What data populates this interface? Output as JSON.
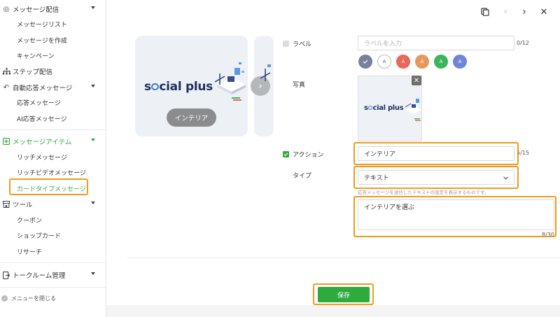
{
  "sidebar": {
    "sections": [
      {
        "label": "メッセージ配信",
        "icon": "broadcast-icon"
      },
      {
        "label": "ステップ配信",
        "icon": "step-icon"
      },
      {
        "label": "自動応答メッセージ",
        "icon": "reply-icon"
      },
      {
        "label": "メッセージアイテム",
        "icon": "message-item-icon"
      },
      {
        "label": "ツール",
        "icon": "shop-icon"
      },
      {
        "label": "トークルーム管理",
        "icon": "talkroom-icon"
      }
    ],
    "items": {
      "message_list": "メッセージリスト",
      "create_message": "メッセージを作成",
      "campaign": "キャンペーン",
      "auto_reply": "応答メッセージ",
      "ai_reply": "AI応答メッセージ",
      "rich_message": "リッチメッセージ",
      "rich_video": "リッチビデオメッセージ",
      "card_type": "カードタイプメッセージ",
      "coupon": "クーポン",
      "shop_card": "ショップカード",
      "research": "リサーチ"
    },
    "collapse_label": "メニューを閉じる",
    "active_color": "#2faa3f"
  },
  "preview": {
    "logo_text": "socialplus",
    "card_button": "インテリア"
  },
  "form": {
    "label_title": "ラベル",
    "label_placeholder": "ラベルを入力",
    "label_counter": "0/12",
    "swatch_letter": "A",
    "swatch_colors": [
      "#7b7f9e",
      "#ffffff",
      "#e8685a",
      "#e8975a",
      "#3cb55a",
      "#6f86d6"
    ],
    "photo_title": "写真",
    "action_title": "アクション",
    "action_value": "インテリア",
    "action_counter": "5/15",
    "type_title": "タイプ",
    "type_value": "テキスト",
    "helper_text": "応答メッセージを送信したテキストの設定を表示するものです。",
    "text_value": "インテリアを選ぶ",
    "text_counter": "8/30",
    "save_label": "保存"
  },
  "highlight_color": "#f39a1e"
}
